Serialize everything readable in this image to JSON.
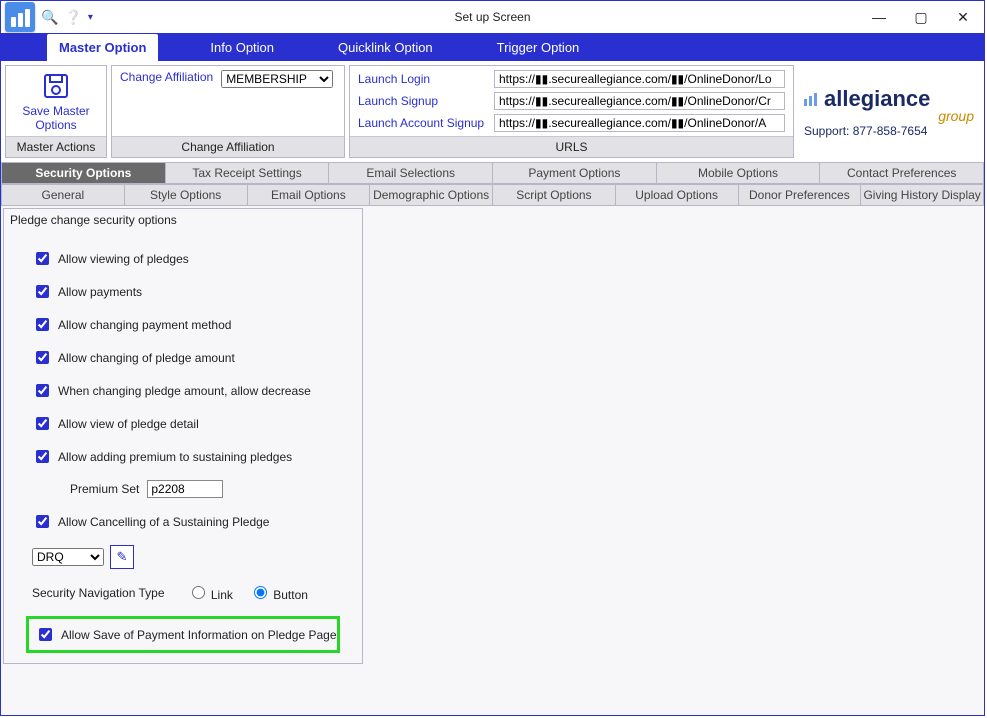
{
  "window": {
    "title": "Set up Screen"
  },
  "tabs": [
    "Master Option",
    "Info Option",
    "Quicklink Option",
    "Trigger Option"
  ],
  "ribbon": {
    "master_actions": {
      "save_line1": "Save Master",
      "save_line2": "Options",
      "footer": "Master Actions"
    },
    "affiliation": {
      "label": "Change Affiliation",
      "value": "MEMBERSHIP",
      "footer": "Change Affiliation"
    },
    "urls": {
      "login_label": "Launch Login",
      "login_val": "https://▮▮.secureallegiance.com/▮▮/OnlineDonor/Lo",
      "signup_label": "Launch Signup",
      "signup_val": "https://▮▮.secureallegiance.com/▮▮/OnlineDonor/Cr",
      "account_label": "Launch Account Signup",
      "account_val": "https://▮▮.secureallegiance.com/▮▮/OnlineDonor/A",
      "footer": "URLS"
    },
    "logo": {
      "name": "allegiance",
      "group": "group",
      "support": "Support: 877-858-7654"
    }
  },
  "subtabs_row1": [
    "Security Options",
    "Tax Receipt Settings",
    "Email Selections",
    "Payment Options",
    "Mobile Options",
    "Contact Preferences"
  ],
  "subtabs_row2": [
    "General",
    "Style Options",
    "Email Options",
    "Demographic Options",
    "Script Options",
    "Upload Options",
    "Donor Preferences",
    "Giving History Display"
  ],
  "group": {
    "title": "Pledge change security options",
    "opts": [
      "Allow viewing of pledges",
      "Allow payments",
      "Allow changing payment method",
      "Allow changing of pledge amount",
      "When changing pledge amount, allow decrease",
      "Allow view of pledge detail",
      "Allow adding premium to sustaining pledges"
    ],
    "premium_label": "Premium Set",
    "premium_val": "p2208",
    "cancel_opt": "Allow Cancelling of a Sustaining Pledge",
    "drq": "DRQ",
    "nav_label": "Security Navigation Type",
    "nav_link": "Link",
    "nav_button": "Button",
    "save_payment": "Allow Save of Payment Information on Pledge Page"
  }
}
